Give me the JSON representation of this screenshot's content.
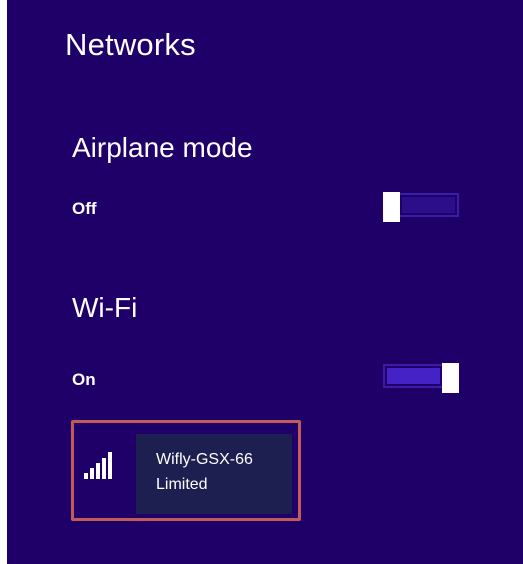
{
  "title": "Networks",
  "airplane_mode": {
    "heading": "Airplane mode",
    "state": "Off",
    "enabled": false
  },
  "wifi": {
    "heading": "Wi-Fi",
    "state": "On",
    "enabled": true
  },
  "network": {
    "name": "Wifly-GSX-66",
    "status": "Limited",
    "signal_bars": 5,
    "signal_bars_filled": 5,
    "signal_icon": "wifi-signal-icon"
  },
  "colors": {
    "panel_background": "#1f0068",
    "toggle_accent": "#4322c6",
    "selection_outline": "#c35a5a",
    "network_card": "#1c1f4f"
  }
}
